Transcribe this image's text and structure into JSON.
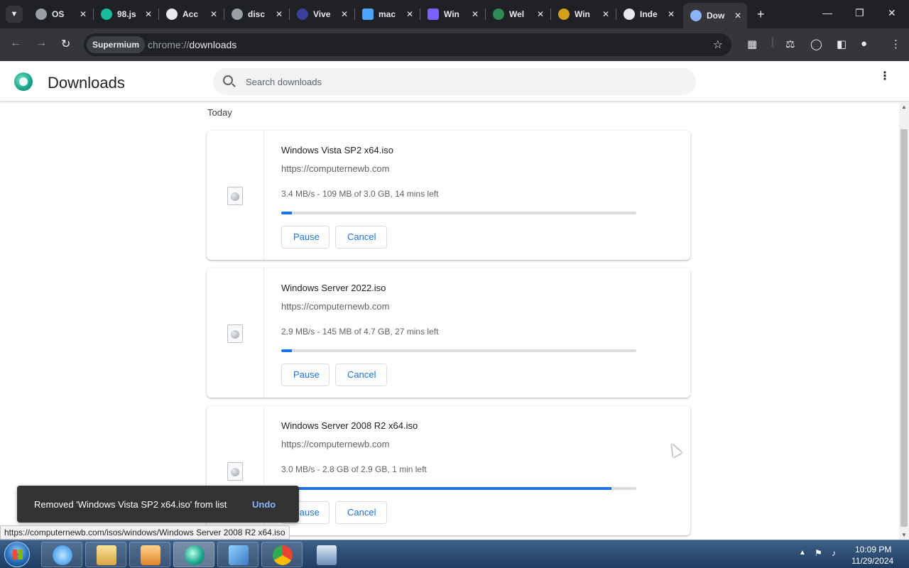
{
  "tabs": [
    {
      "title": "OS",
      "favicon": "globe-icon",
      "color": "#9aa0a6"
    },
    {
      "title": "98.js",
      "favicon": "windows98-icon",
      "color": "#1abc9c"
    },
    {
      "title": "Acc",
      "favicon": "github-icon",
      "color": "#e8eaed"
    },
    {
      "title": "disc",
      "favicon": "globe-icon",
      "color": "#9aa0a6"
    },
    {
      "title": "Vive",
      "favicon": "vp-icon",
      "color": "#3b3f99"
    },
    {
      "title": "mac",
      "favicon": "mac-icon",
      "color": "#4aa3ff"
    },
    {
      "title": "Win",
      "favicon": "windows-icon",
      "color": "#7b61ff"
    },
    {
      "title": "Wel",
      "favicon": "earth-icon",
      "color": "#2e8b57"
    },
    {
      "title": "Win",
      "favicon": "shield-icon",
      "color": "#d4a017"
    },
    {
      "title": "Inde",
      "favicon": "github-icon",
      "color": "#e8eaed"
    },
    {
      "title": "Dow",
      "favicon": "download-icon",
      "color": "#8ab4f8",
      "active": true
    }
  ],
  "toolbar": {
    "profile_chip": "Supermium",
    "url_scheme": "chrome://",
    "url_host": "downloads"
  },
  "header": {
    "title": "Downloads",
    "search_placeholder": "Search downloads"
  },
  "section_label": "Today",
  "downloads": [
    {
      "name": "Windows Vista SP2 x64.iso",
      "source": "https://computernewb.com",
      "status": "3.4 MB/s - 109 MB of 3.0 GB, 14 mins left",
      "progress": 0.03,
      "pause_label": "Pause",
      "cancel_label": "Cancel"
    },
    {
      "name": "Windows Server 2022.iso",
      "source": "https://computernewb.com",
      "status": "2.9 MB/s - 145 MB of 4.7 GB, 27 mins left",
      "progress": 0.03,
      "pause_label": "Pause",
      "cancel_label": "Cancel"
    },
    {
      "name": "Windows Server 2008 R2 x64.iso",
      "source": "https://computernewb.com",
      "status": "3.0 MB/s - 2.8 GB of 2.9 GB, 1 min left",
      "progress": 0.93,
      "pause_label": "Pause",
      "cancel_label": "Cancel"
    }
  ],
  "toast": {
    "message": "Removed 'Windows Vista SP2 x64.iso' from list",
    "action": "Undo"
  },
  "status_bubble": "https://computernewb.com/isos/windows/Windows Server 2008 R2 x64.iso",
  "taskbar": {
    "apps": [
      "internet-explorer-icon",
      "file-explorer-icon",
      "media-player-icon",
      "supermium-icon",
      "control-panel-icon",
      "chrome-icon",
      "network-icon"
    ],
    "time": "10:09 PM",
    "date": "11/29/2024"
  },
  "colors": {
    "accent": "#1a73e8",
    "tabstrip": "#202124",
    "toolbar": "#35363a"
  }
}
